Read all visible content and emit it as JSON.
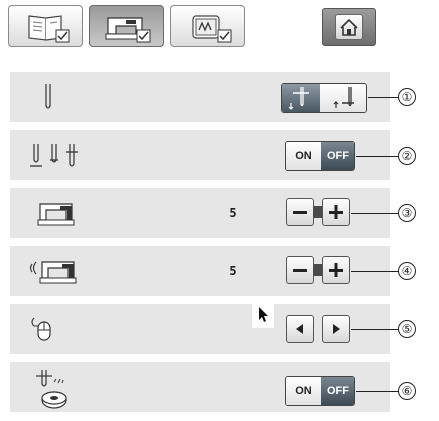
{
  "tabs": [
    {
      "icon": "book-settings-icon",
      "active": false
    },
    {
      "icon": "sewing-machine-settings-icon",
      "active": true
    },
    {
      "icon": "embroidery-settings-icon",
      "active": false
    }
  ],
  "home": {
    "icon": "home-icon"
  },
  "rows": [
    {
      "icon": "needle-icon",
      "control": "needle-position-toggle",
      "callout": "①"
    },
    {
      "icon": "needle-sensor-icon",
      "control": "on-off-toggle",
      "on_label": "ON",
      "off_label": "OFF",
      "callout": "②"
    },
    {
      "icon": "machine-light-icon",
      "value": "5",
      "control": "plus-minus",
      "callout": "③"
    },
    {
      "icon": "machine-sound-icon",
      "value": "5",
      "control": "plus-minus",
      "callout": "④"
    },
    {
      "icon": "mouse-icon",
      "control": "pointer-arrows",
      "pointer_icon": "pointer-arrow-icon",
      "callout": "⑤"
    },
    {
      "icon": "bobbin-sensor-icon",
      "control": "on-off-toggle",
      "on_label": "ON",
      "off_label": "OFF",
      "callout": "⑥"
    }
  ],
  "colors": {
    "row_bg": "#e6e6e6",
    "active_tab": "#9a9a9a",
    "off_active": "#4a5864"
  }
}
